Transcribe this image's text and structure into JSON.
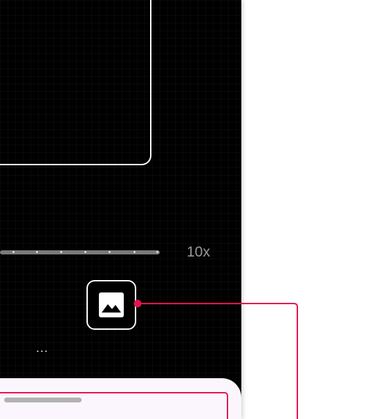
{
  "camera": {
    "zoom_label": "10x",
    "ellipsis": "..."
  },
  "gallery_button": {
    "icon": "image-icon"
  },
  "colors": {
    "screen_bg": "#000000",
    "frame": "#ffffff",
    "highlight": "#e5134e",
    "sheet_bg": "#fbf6fd"
  }
}
